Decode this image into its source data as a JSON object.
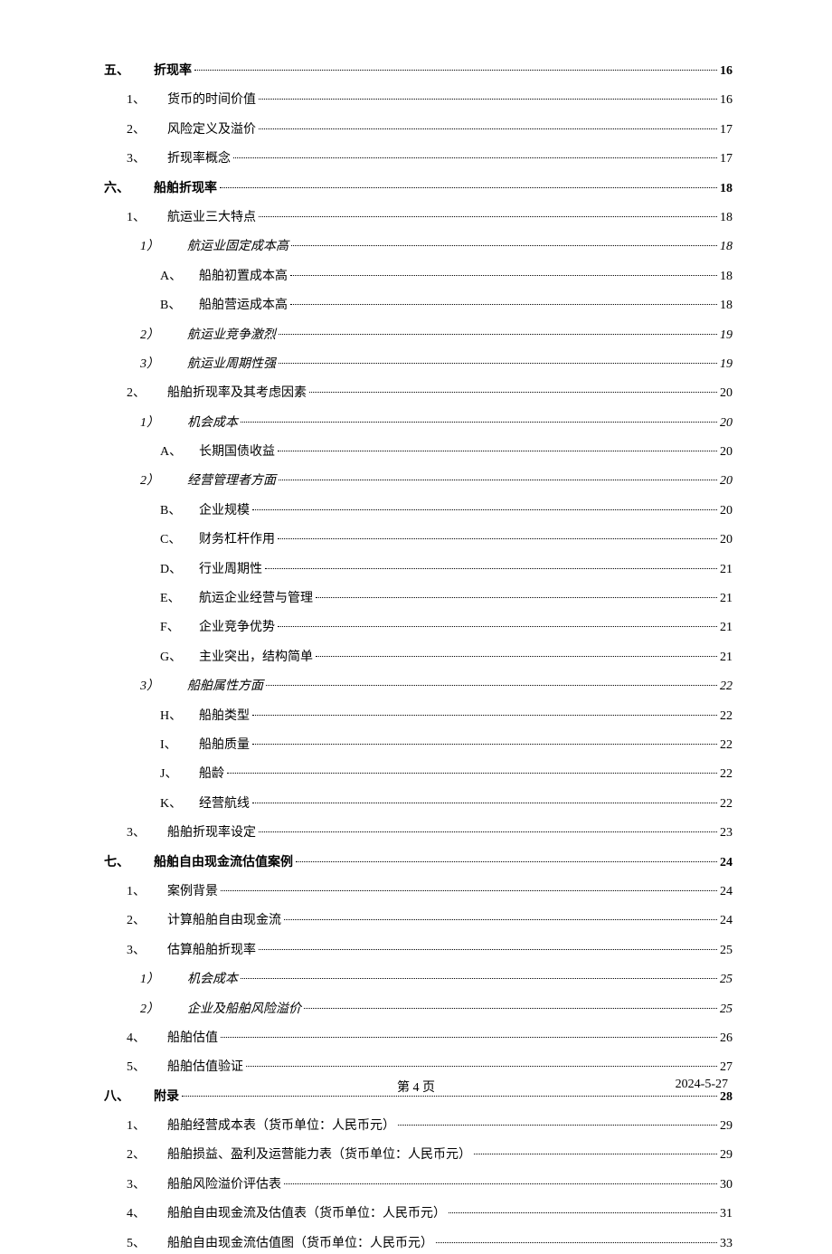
{
  "toc": [
    {
      "level": "h",
      "num": "五、",
      "title": "折现率",
      "page": "16",
      "bold": true
    },
    {
      "level": "1",
      "num": "1、",
      "title": "货币的时间价值",
      "page": "16"
    },
    {
      "level": "1",
      "num": "2、",
      "title": "风险定义及溢价",
      "page": "17"
    },
    {
      "level": "1",
      "num": "3、",
      "title": "折现率概念",
      "page": "17"
    },
    {
      "level": "h",
      "num": "六、",
      "title": "船舶折现率",
      "page": "18",
      "bold": true
    },
    {
      "level": "1",
      "num": "1、",
      "title": "航运业三大特点",
      "page": "18"
    },
    {
      "level": "2",
      "num": "1）",
      "title": "航运业固定成本高",
      "page": "18",
      "italic": true
    },
    {
      "level": "3",
      "num": "A、",
      "title": "船舶初置成本高",
      "page": "18"
    },
    {
      "level": "3",
      "num": "B、",
      "title": "船舶营运成本高",
      "page": "18"
    },
    {
      "level": "2",
      "num": "2）",
      "title": "航运业竞争激烈",
      "page": "19",
      "italic": true
    },
    {
      "level": "2",
      "num": "3）",
      "title": "航运业周期性强",
      "page": "19",
      "italic": true
    },
    {
      "level": "1",
      "num": "2、",
      "title": "船舶折现率及其考虑因素",
      "page": "20"
    },
    {
      "level": "2",
      "num": "1）",
      "title": "机会成本",
      "page": "20",
      "italic": true
    },
    {
      "level": "3",
      "num": "A、",
      "title": "长期国债收益",
      "page": "20"
    },
    {
      "level": "2",
      "num": "2）",
      "title": "经营管理者方面",
      "page": "20",
      "italic": true
    },
    {
      "level": "3",
      "num": "B、",
      "title": "企业规模",
      "page": "20"
    },
    {
      "level": "3",
      "num": "C、",
      "title": "财务杠杆作用",
      "page": "20"
    },
    {
      "level": "3",
      "num": "D、",
      "title": "行业周期性",
      "page": "21"
    },
    {
      "level": "3",
      "num": "E、",
      "title": "航运企业经营与管理",
      "page": "21"
    },
    {
      "level": "3",
      "num": "F、",
      "title": "企业竞争优势",
      "page": "21"
    },
    {
      "level": "3",
      "num": "G、",
      "title": "主业突出，结构简单",
      "page": "21"
    },
    {
      "level": "2",
      "num": "3）",
      "title": "船舶属性方面",
      "page": "22",
      "italic": true
    },
    {
      "level": "3",
      "num": "H、",
      "title": "船舶类型",
      "page": "22"
    },
    {
      "level": "3",
      "num": "I、",
      "title": "船舶质量",
      "page": "22"
    },
    {
      "level": "3",
      "num": "J、",
      "title": "船龄",
      "page": "22"
    },
    {
      "level": "3",
      "num": "K、",
      "title": "经营航线",
      "page": "22"
    },
    {
      "level": "1",
      "num": "3、",
      "title": "船舶折现率设定",
      "page": "23"
    },
    {
      "level": "h",
      "num": "七、",
      "title": "船舶自由现金流估值案例",
      "page": "24",
      "bold": true
    },
    {
      "level": "1",
      "num": "1、",
      "title": "案例背景",
      "page": "24"
    },
    {
      "level": "1",
      "num": "2、",
      "title": "计算船舶自由现金流",
      "page": "24"
    },
    {
      "level": "1",
      "num": "3、",
      "title": "估算船舶折现率",
      "page": "25"
    },
    {
      "level": "2",
      "num": "1）",
      "title": "机会成本",
      "page": "25",
      "italic": true
    },
    {
      "level": "2",
      "num": "2）",
      "title": "企业及船舶风险溢价",
      "page": "25",
      "italic": true
    },
    {
      "level": "1",
      "num": "4、",
      "title": "船舶估值",
      "page": "26"
    },
    {
      "level": "1",
      "num": "5、",
      "title": "船舶估值验证",
      "page": "27"
    },
    {
      "level": "h",
      "num": "八、",
      "title": "附录",
      "page": "28",
      "bold": true
    },
    {
      "level": "1",
      "num": "1、",
      "title": "船舶经营成本表（货币单位：人民币元）",
      "page": "29"
    },
    {
      "level": "1",
      "num": "2、",
      "title": "船舶损益、盈利及运营能力表（货币单位：人民币元）",
      "page": "29"
    },
    {
      "level": "1",
      "num": "3、",
      "title": "船舶风险溢价评估表",
      "page": "30"
    },
    {
      "level": "1",
      "num": "4、",
      "title": "船舶自由现金流及估值表（货币单位：人民币元）",
      "page": "31"
    },
    {
      "level": "1",
      "num": "5、",
      "title": "船舶自由现金流估值图（货币单位：人民币元）",
      "page": "33"
    }
  ],
  "footer": {
    "center": "第 4 页",
    "right": "2024-5-27"
  }
}
